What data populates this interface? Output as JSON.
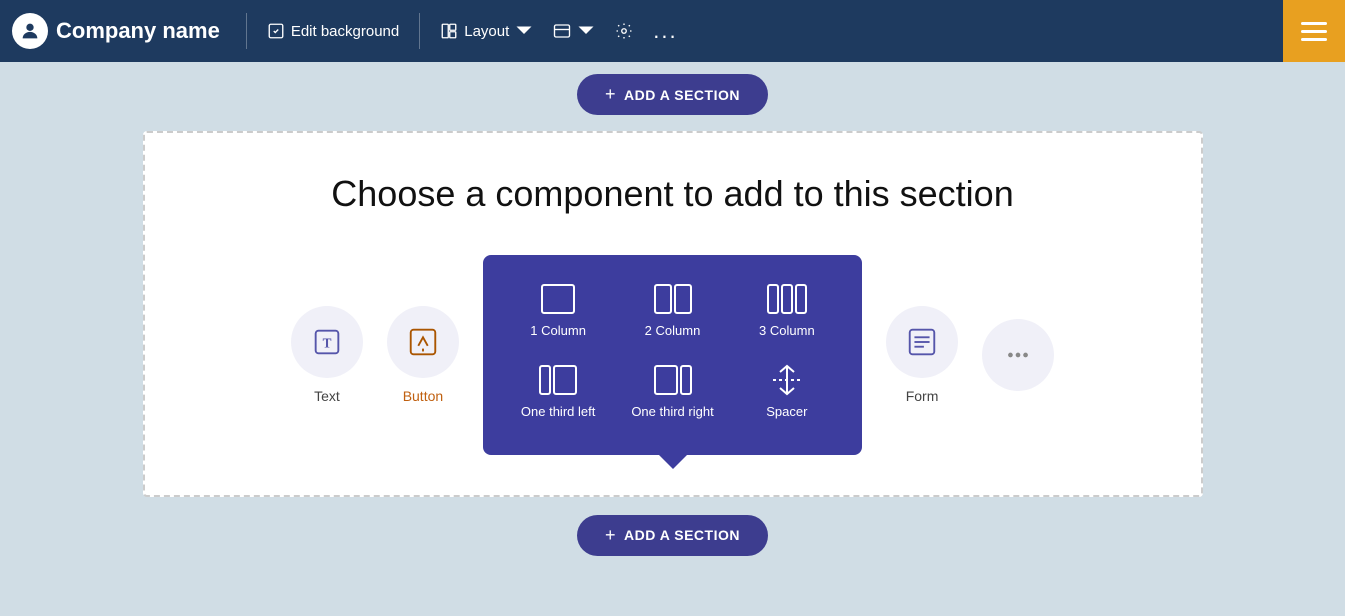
{
  "toolbar": {
    "company_name": "Company name",
    "edit_background_label": "Edit background",
    "layout_label": "Layout",
    "section_label": "Section",
    "settings_label": "Settings",
    "more_label": "More options"
  },
  "add_section": {
    "top_label": "ADD A SECTION",
    "bottom_label": "ADD A SECTION",
    "plus_icon": "+"
  },
  "section": {
    "title": "Choose a component to add to this section"
  },
  "components": {
    "text_label": "Text",
    "button_label": "Button",
    "form_label": "Form",
    "more_label": "..."
  },
  "layout_items": [
    {
      "id": "1column",
      "label": "1 Column"
    },
    {
      "id": "2column",
      "label": "2 Column"
    },
    {
      "id": "3column",
      "label": "3 Column"
    },
    {
      "id": "one-third-left",
      "label": "One third left"
    },
    {
      "id": "one-third-right",
      "label": "One third right"
    },
    {
      "id": "spacer",
      "label": "Spacer"
    }
  ]
}
